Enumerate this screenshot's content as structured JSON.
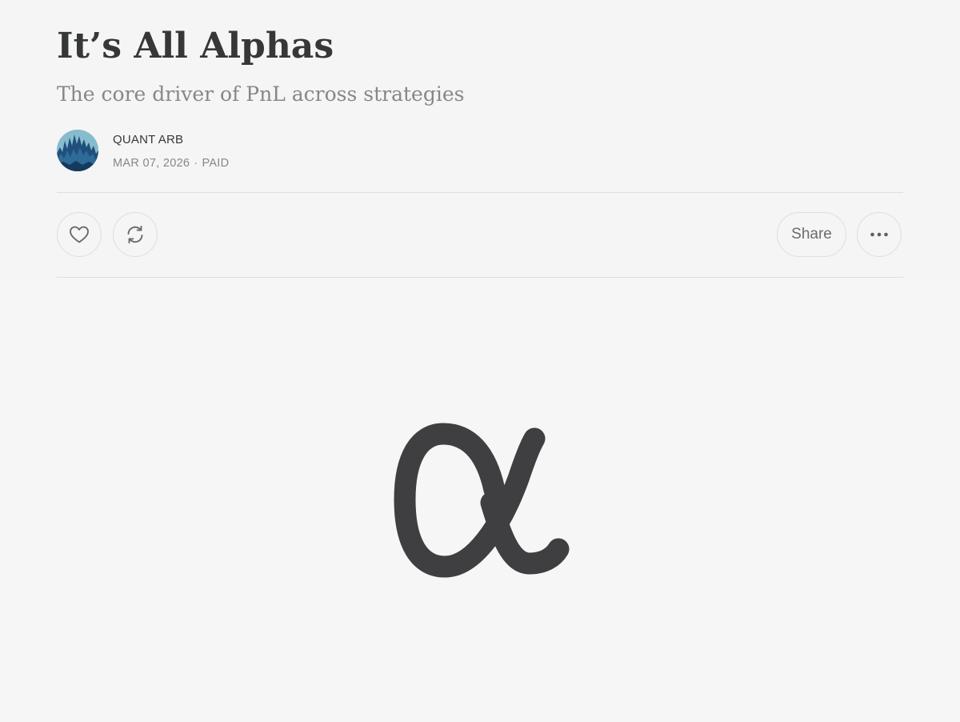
{
  "post": {
    "title": "It’s All Alphas",
    "subtitle": "The core driver of PnL across strategies"
  },
  "byline": {
    "author": "QUANT ARB",
    "date": "MAR 07, 2026",
    "separator": "·",
    "access": "PAID",
    "avatar_icon": "author-avatar-image"
  },
  "actions": {
    "like_icon": "heart-icon",
    "restack_icon": "restack-icon",
    "share_label": "Share",
    "more_icon": "ellipsis-icon"
  },
  "hero": {
    "symbol_icon": "alpha-symbol-image"
  },
  "colors": {
    "background": "#f5f5f5",
    "text": "#363737",
    "muted_text": "#868787",
    "divider": "#dedede",
    "symbol": "#3f3f41"
  }
}
